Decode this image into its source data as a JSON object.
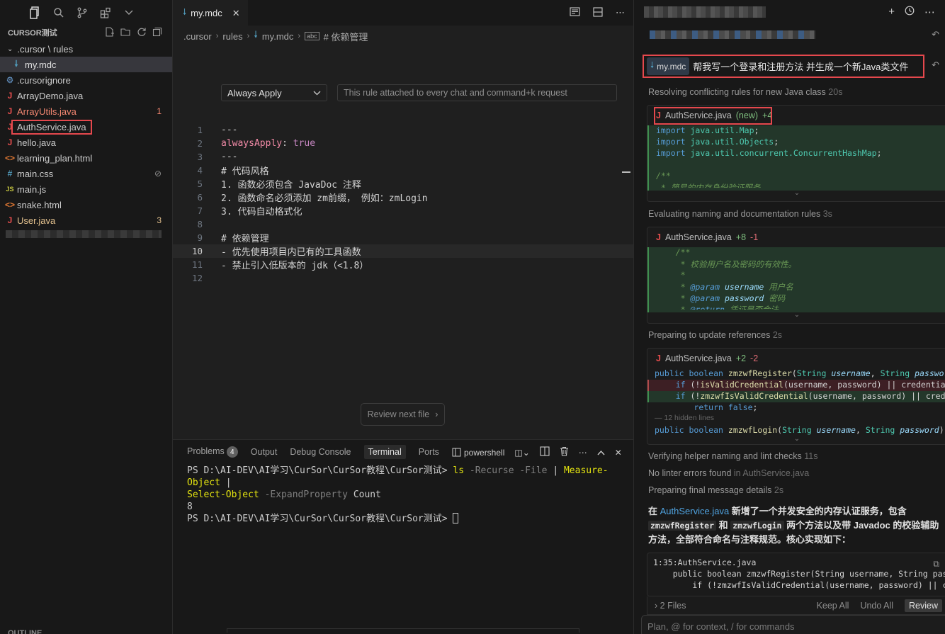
{
  "sidebar": {
    "title": "CURSOR测试",
    "folder_path": ".cursor \\ rules",
    "files": [
      {
        "name": "my.mdc",
        "icon": "download-arrow-icon",
        "selected": true
      },
      {
        "name": ".cursorignore",
        "icon": "gear-dot-icon"
      },
      {
        "name": "ArrayDemo.java",
        "icon": "java-icon"
      },
      {
        "name": "ArrayUtils.java",
        "icon": "java-icon",
        "badge": "1",
        "error": true
      },
      {
        "name": "AuthService.java",
        "icon": "java-icon",
        "highlighted": true
      },
      {
        "name": "hello.java",
        "icon": "java-icon"
      },
      {
        "name": "learning_plan.html",
        "icon": "html-icon"
      },
      {
        "name": "main.css",
        "icon": "css-icon",
        "badge": "⊘"
      },
      {
        "name": "main.js",
        "icon": "js-icon"
      },
      {
        "name": "snake.html",
        "icon": "html-icon"
      },
      {
        "name": "User.java",
        "icon": "java-icon",
        "badge": "3",
        "warning": true
      }
    ],
    "outline_label": "OUTLINE"
  },
  "editor": {
    "tab_label": "my.mdc",
    "breadcrumb": [
      ".cursor",
      "rules",
      "my.mdc",
      "# 依赖管理"
    ],
    "rule_type": "Always Apply",
    "rule_description": "This rule attached to every chat and command+k request",
    "lines": [
      {
        "n": "1",
        "text": "---"
      },
      {
        "n": "2",
        "key": "alwaysApply",
        "sep": ": ",
        "val": "true"
      },
      {
        "n": "3",
        "text": "---"
      },
      {
        "n": "4",
        "text": "# 代码风格"
      },
      {
        "n": "5",
        "text": "1. 函数必须包含 JavaDoc 注释"
      },
      {
        "n": "6",
        "text": "2. 函数命名必须添加 zm前缀， 例如：zmLogin"
      },
      {
        "n": "7",
        "text": "3. 代码自动格式化"
      },
      {
        "n": "8",
        "text": ""
      },
      {
        "n": "9",
        "text": "# 依赖管理"
      },
      {
        "n": "10",
        "text": "- 优先使用项目内已有的工具函数",
        "current": true
      },
      {
        "n": "11",
        "text": "- 禁止引入低版本的 jdk（<1.8）"
      },
      {
        "n": "12",
        "text": ""
      }
    ],
    "review_next": "Review next file"
  },
  "panel": {
    "tabs": [
      "Problems",
      "Output",
      "Debug Console",
      "Terminal",
      "Ports"
    ],
    "problems_count": "4",
    "active_tab": "Terminal",
    "shell_label": "powershell",
    "terminal": {
      "prompt1": "PS D:\\AI-DEV\\AI学习\\CurSor\\CurSor教程\\CurSor测试> ",
      "cmd_ls": "ls",
      "arg1": " -Recurse -File ",
      "pipe1": "| ",
      "cmd_measure": "Measure-Object",
      "pipe2": " |",
      "cmd_select": "Select-Object",
      "arg2": " -ExpandProperty ",
      "arg2_val": "Count",
      "output": "8",
      "prompt2": "PS D:\\AI-DEV\\AI学习\\CurSor\\CurSor教程\\CurSor测试> "
    }
  },
  "chat": {
    "user_file_pill": "my.mdc",
    "user_message": "帮我写一个登录和注册方法 并生成一个新Java类文件",
    "steps": [
      {
        "label": "Resolving conflicting rules for new Java class",
        "time": "20s"
      },
      {
        "label": "Evaluating naming and documentation rules",
        "time": "3s"
      },
      {
        "label": "Preparing to update references",
        "time": "2s"
      },
      {
        "label": "Verifying helper naming and lint checks",
        "time": "11s"
      },
      {
        "label": "No linter errors found",
        "suffix": "in AuthService.java"
      },
      {
        "label": "Preparing final message details",
        "time": "2s"
      }
    ],
    "card1": {
      "file": "AuthService.java",
      "tag": "(new)",
      "adds": "+4",
      "lines": [
        "import java.util.Map;",
        "import java.util.Objects;",
        "import java.util.concurrent.ConcurrentHashMap;",
        "",
        "/**",
        " * 简易的内存身份验证服务。"
      ]
    },
    "card2": {
      "file": "AuthService.java",
      "adds": "+8",
      "dels": "-1",
      "lines": [
        "    /**",
        "     * 校验用户名及密码的有效性。",
        "     *",
        "     * @param username 用户名",
        "     * @param password 密码",
        "     * @return 凭证是否合法"
      ]
    },
    "card3": {
      "file": "AuthService.java",
      "adds": "+2",
      "dels": "-2",
      "hidden": "12 hidden lines"
    },
    "answer": {
      "p1": "在 ",
      "file": "AuthService.java",
      "p2": " 新增了一个并发安全的内存认证服务，包含 ",
      "c1": "zmzwfRegister",
      "p3": " 和 ",
      "c2": "zmzwfLogin",
      "p4": " 两个方法以及带 Javadoc 的校验辅助方法，全部符合命名与注释规范。核心实现如下："
    },
    "answer_code": {
      "ref": "1:35:AuthService.java",
      "line1": "    public boolean zmzwfRegister(String username, String passw",
      "line2": "        if (!zmzwfIsValidCredential(username, password) || cre"
    },
    "footer": {
      "files": "2 Files",
      "keep": "Keep All",
      "undo": "Undo All",
      "review": "Review"
    },
    "input_placeholder": "Plan, @ for context, / for commands"
  }
}
